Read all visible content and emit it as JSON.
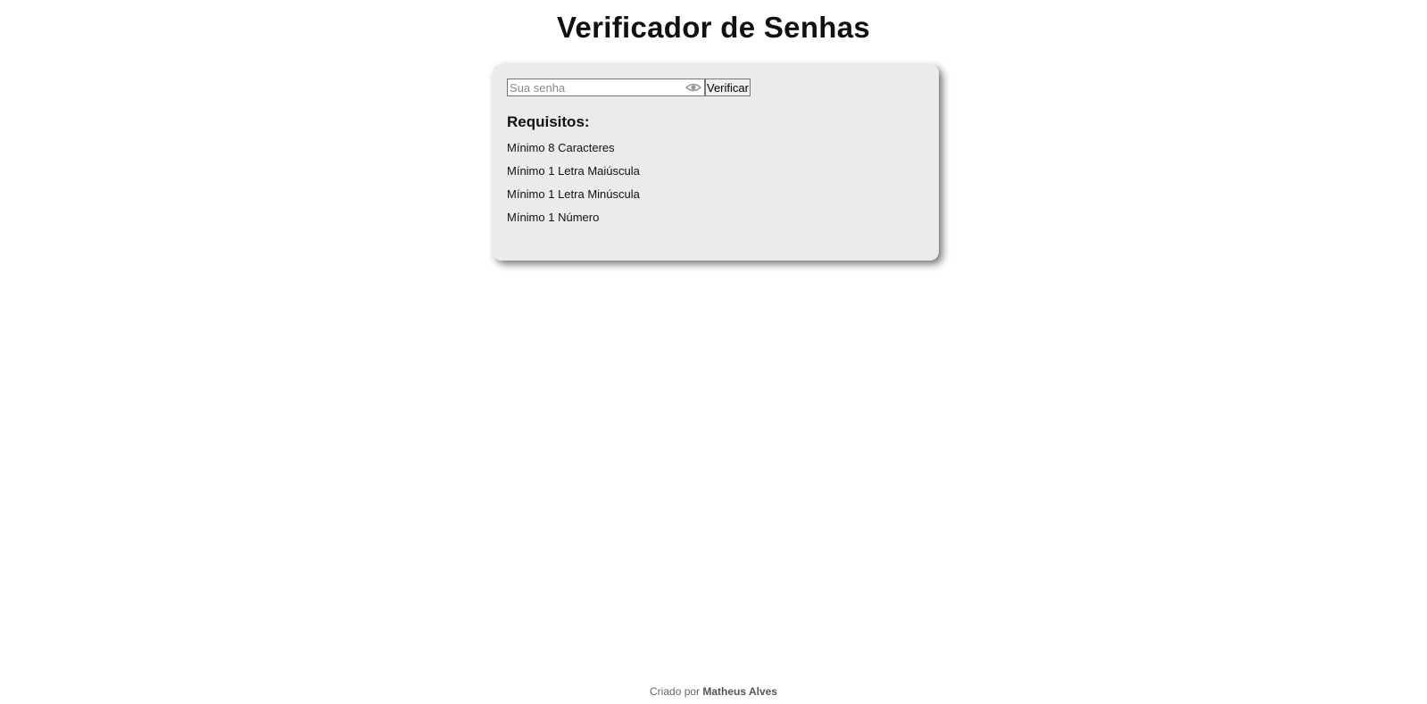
{
  "header": {
    "title": "Verificador de Senhas"
  },
  "form": {
    "password_placeholder": "Sua senha",
    "password_value": "",
    "toggle_icon": "eye-icon",
    "verify_label": "Verificar"
  },
  "requirements": {
    "heading": "Requisitos:",
    "items": [
      "Mínimo 8 Caracteres",
      "Mínimo 1 Letra Maiúscula",
      "Mínimo 1 Letra Minúscula",
      "Mínimo 1 Número"
    ]
  },
  "footer": {
    "prefix": "Criado por",
    "author": "Matheus Alves"
  },
  "colors": {
    "card_background": "#ebebeb",
    "page_background": "#ffffff",
    "text": "#111111"
  }
}
